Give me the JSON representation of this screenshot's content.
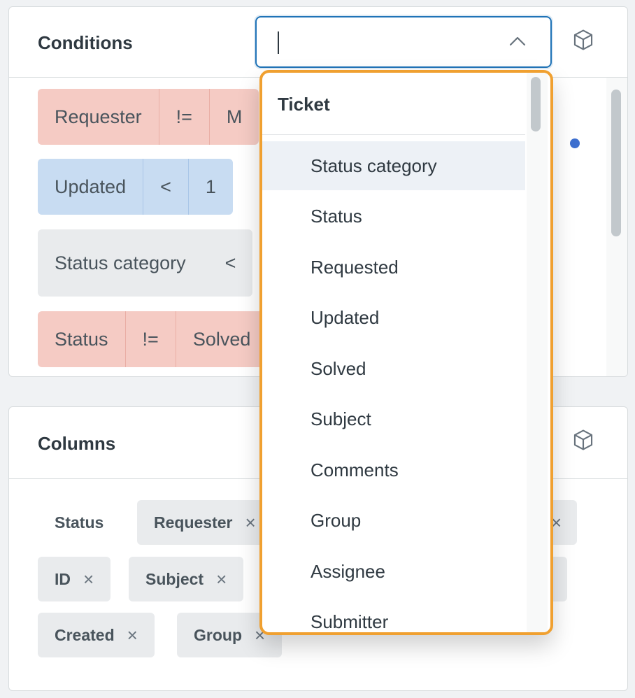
{
  "conditions": {
    "title": "Conditions",
    "rows": [
      {
        "segments": [
          "Requester",
          "!=",
          "M"
        ]
      },
      {
        "segments": [
          "Updated",
          "<",
          "1"
        ]
      },
      {
        "segments": [
          "Status category",
          "<"
        ]
      },
      {
        "segments": [
          "Status",
          "!=",
          "Solved"
        ]
      }
    ]
  },
  "columns": {
    "title": "Columns",
    "chips": {
      "status": "Status",
      "requester": "Requester",
      "id": "ID",
      "subject": "Subject",
      "created": "Created",
      "group": "Group"
    },
    "remove_glyph": "×"
  },
  "combobox": {
    "value": ""
  },
  "dropdown": {
    "group_label": "Ticket",
    "active_index": 0,
    "items": [
      "Status category",
      "Status",
      "Requested",
      "Updated",
      "Solved",
      "Subject",
      "Comments",
      "Group",
      "Assignee",
      "Submitter"
    ]
  },
  "colors": {
    "focus_border": "#1f73b7",
    "highlight_outline": "#f0a030",
    "row_red": "#f5cbc4",
    "row_blue": "#c8dcf2",
    "row_gray": "#e9ebed",
    "dot_blue": "#3d6fcf"
  }
}
